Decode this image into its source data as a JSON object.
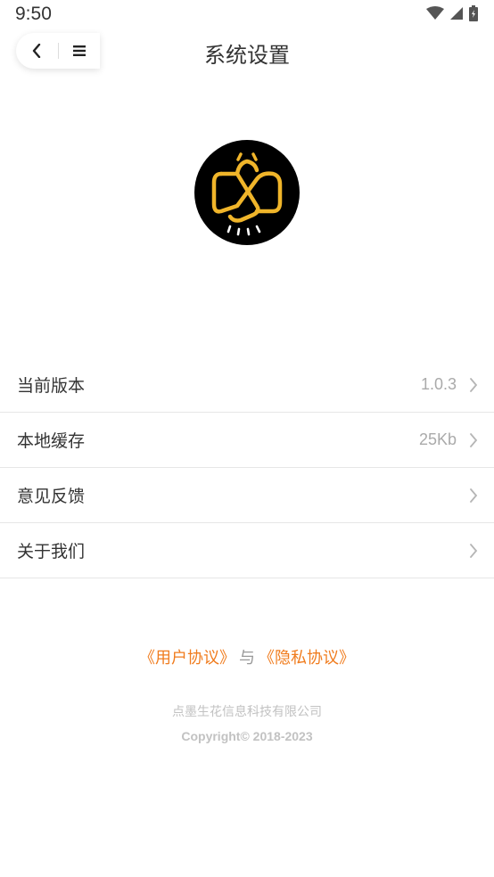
{
  "status_bar": {
    "time": "9:50"
  },
  "header": {
    "title": "系统设置"
  },
  "settings": [
    {
      "label": "当前版本",
      "value": "1.0.3"
    },
    {
      "label": "本地缓存",
      "value": "25Kb"
    },
    {
      "label": "意见反馈",
      "value": ""
    },
    {
      "label": "关于我们",
      "value": ""
    }
  ],
  "footer": {
    "user_agreement": "《用户协议》",
    "connector": "与",
    "privacy_agreement": "《隐私协议》",
    "company": "点墨生花信息科技有限公司",
    "copyright": "Copyright© 2018-2023"
  },
  "colors": {
    "accent": "#f07c1e",
    "logo_bg": "#000000",
    "logo_fg": "#f0b52a"
  }
}
